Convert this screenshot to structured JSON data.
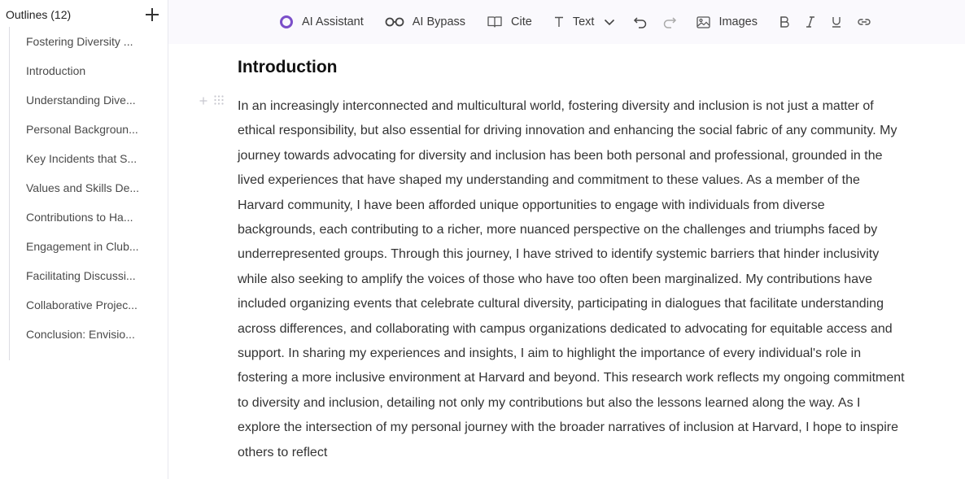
{
  "sidebar": {
    "title": "Outlines (12)",
    "items": [
      "Fostering Diversity ...",
      "Introduction",
      "Understanding Dive...",
      "Personal Backgroun...",
      "Key Incidents that S...",
      "Values and Skills De...",
      "Contributions to Ha...",
      "Engagement in Club...",
      "Facilitating Discussi...",
      "Collaborative Projec...",
      "Conclusion: Envisio..."
    ]
  },
  "toolbar": {
    "ai_assistant": "AI Assistant",
    "ai_bypass": "AI Bypass",
    "cite": "Cite",
    "text": "Text",
    "images": "Images"
  },
  "document": {
    "heading": "Introduction",
    "paragraph": "In an increasingly interconnected and multicultural world, fostering diversity and inclusion is not just a matter of ethical responsibility, but also essential for driving innovation and enhancing the social fabric of any community. My journey towards advocating for diversity and inclusion has been both personal and professional, grounded in the lived experiences that have shaped my understanding and commitment to these values. As a member of the Harvard community, I have been afforded unique opportunities to engage with individuals from diverse backgrounds, each contributing to a richer, more nuanced perspective on the challenges and triumphs faced by underrepresented groups. Through this journey, I have strived to identify systemic barriers that hinder inclusivity while also seeking to amplify the voices of those who have too often been marginalized. My contributions have included organizing events that celebrate cultural diversity, participating in dialogues that facilitate understanding across differences, and collaborating with campus organizations dedicated to advocating for equitable access and support. In sharing my experiences and insights, I aim to highlight the importance of every individual's role in fostering a more inclusive environment at Harvard and beyond. This research work reflects my ongoing commitment to diversity and inclusion, detailing not only my contributions but also the lessons learned along the way. As I explore the intersection of my personal journey with the broader narratives of inclusion at Harvard, I hope to inspire others to reflect"
  },
  "colors": {
    "accent": "#7b4fc9",
    "toolbar_bg": "#faf9fd",
    "text": "#333333"
  }
}
